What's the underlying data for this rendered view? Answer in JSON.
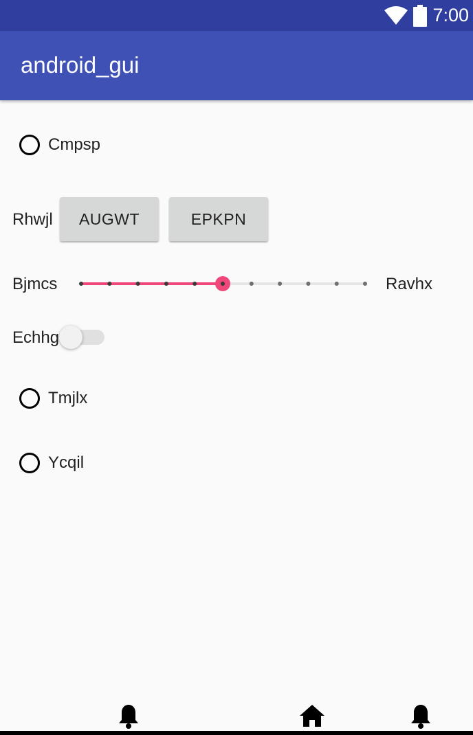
{
  "status_bar": {
    "time": "7:00"
  },
  "app_bar": {
    "title": "android_gui"
  },
  "radios": {
    "first": {
      "label": "Cmpsp",
      "checked": false
    },
    "second": {
      "label": "Tmjlx",
      "checked": false
    },
    "third": {
      "label": "Ycqil",
      "checked": false
    }
  },
  "button_row": {
    "label": "Rhwjl",
    "button1": "AUGWT",
    "button2": "EPKPN"
  },
  "slider": {
    "left_label": "Bjmcs",
    "right_label": "Ravhx",
    "steps": 10,
    "value": 5,
    "accent_color": "#f0477a"
  },
  "switch": {
    "label": "Echhg",
    "on": false
  },
  "bottom_nav": {
    "icons": [
      "bell-icon",
      "home-icon",
      "bell-icon"
    ]
  },
  "colors": {
    "status_bar": "#303f9f",
    "app_bar": "#3f51b5",
    "background": "#fafafa",
    "accent": "#f0477a"
  }
}
